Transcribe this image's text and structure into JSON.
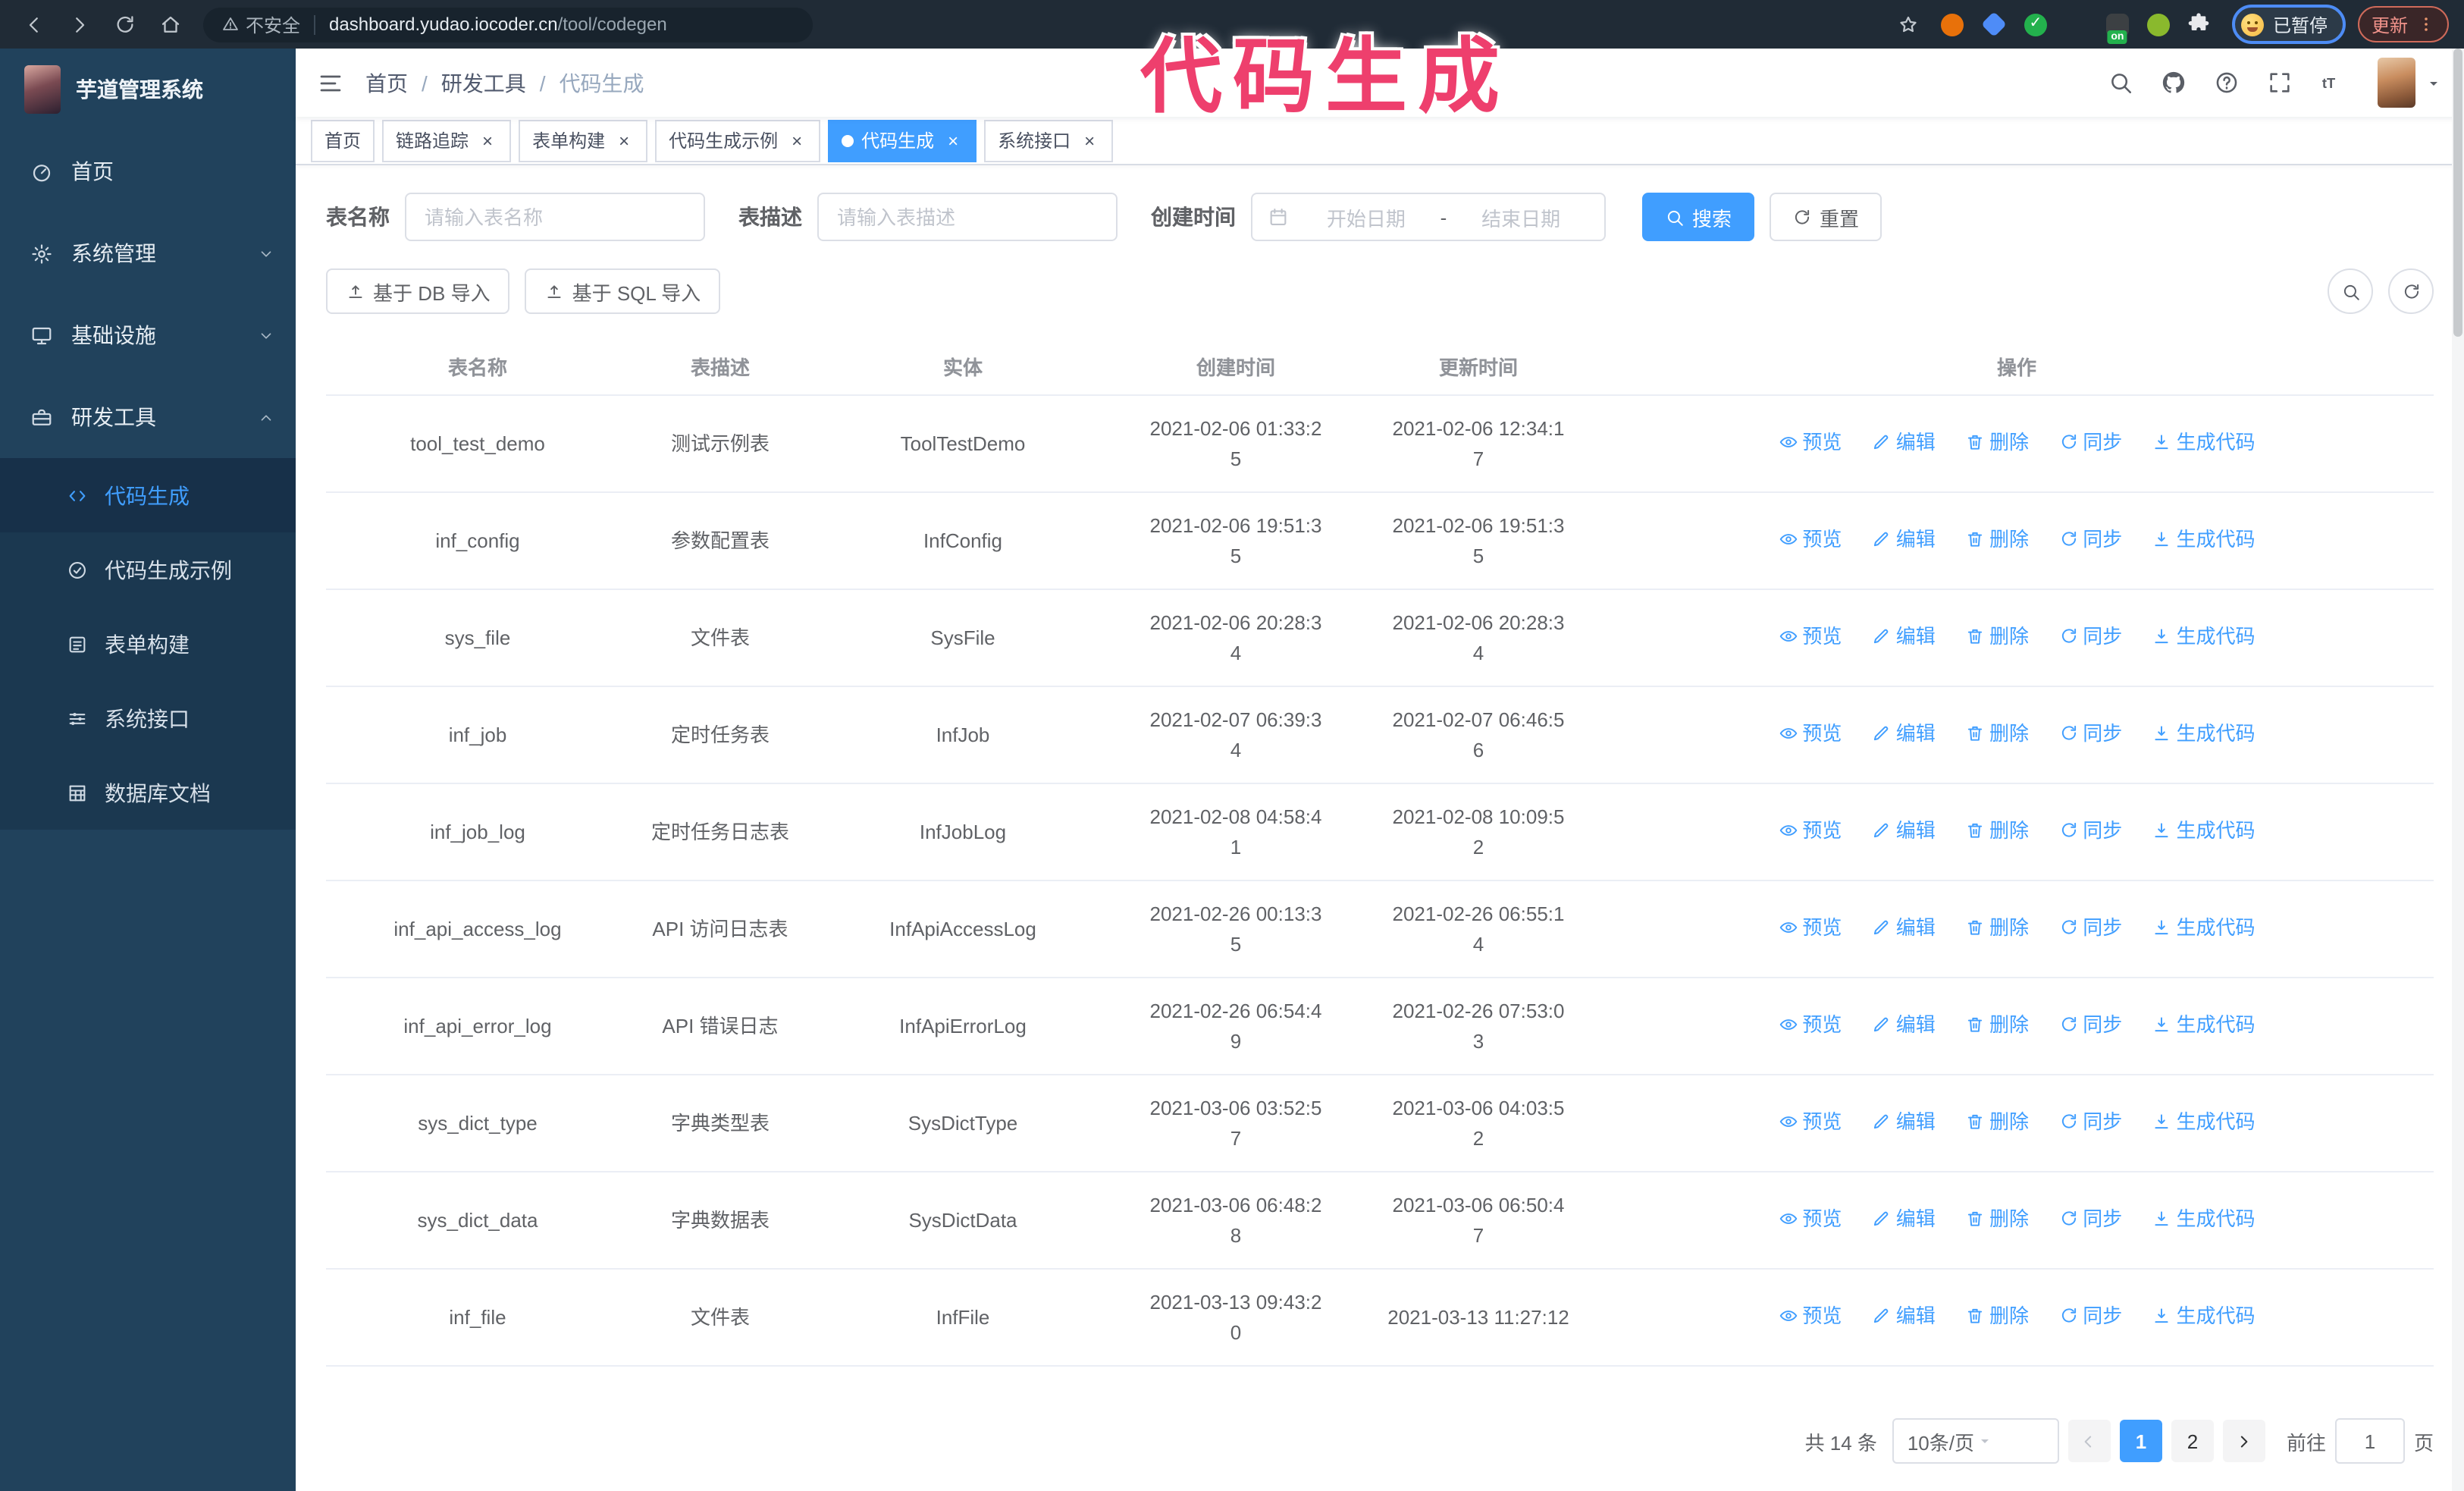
{
  "colors": {
    "accent": "#409eff",
    "annotation": "#ee3f6d",
    "sidebar_bg": "#21425c",
    "submenu_bg": "#1b3850",
    "chrome_bg": "#202b36"
  },
  "annotation": {
    "text": "代码生成"
  },
  "browser": {
    "nav_icons": [
      {
        "name": "back-icon"
      },
      {
        "name": "forward-icon"
      },
      {
        "name": "reload-icon"
      },
      {
        "name": "home-icon"
      }
    ],
    "security_icon": "warning-icon",
    "security_label": "不安全",
    "url_host": "dashboard.yudao.iocoder.cn",
    "url_path": "/tool/codegen",
    "star_icon": "star-icon",
    "extensions": [
      {
        "name": "orange-extension-icon",
        "shape": "circle",
        "color": "#e8710a"
      },
      {
        "name": "blue-gem-extension-icon",
        "shape": "diamond",
        "color": "#4e8cf7"
      },
      {
        "name": "green-shield-extension-icon",
        "shape": "circle",
        "color": "#23b14d",
        "glyph": "✓"
      },
      {
        "name": "grid-extension-icon",
        "shape": "grid",
        "color": "#aeb4ba"
      },
      {
        "name": "dark-extension-icon",
        "shape": "square",
        "color": "#3c4043",
        "badge": "on"
      },
      {
        "name": "green-bot-extension-icon",
        "shape": "circle",
        "color": "#8ab92d"
      },
      {
        "name": "puzzle-extension-icon",
        "shape": "puzzle",
        "color": "#e8eaed"
      }
    ],
    "paused_label": "已暂停",
    "update_label": "更新",
    "update_menu_icon": "dots-vertical-icon"
  },
  "sidebar": {
    "title": "芋道管理系统",
    "items": [
      {
        "id": "home",
        "label": "首页",
        "icon": "dashboard-icon",
        "chevron": null
      },
      {
        "id": "system",
        "label": "系统管理",
        "icon": "gear-icon",
        "chevron": "chevron-down-icon"
      },
      {
        "id": "infra",
        "label": "基础设施",
        "icon": "monitor-icon",
        "chevron": "chevron-down-icon"
      },
      {
        "id": "devtools",
        "label": "研发工具",
        "icon": "toolbox-icon",
        "chevron": "chevron-up-icon"
      }
    ],
    "subitems": [
      {
        "id": "codegen",
        "label": "代码生成",
        "icon": "code-icon",
        "active": true
      },
      {
        "id": "codegen-example",
        "label": "代码生成示例",
        "icon": "example-icon",
        "active": false
      },
      {
        "id": "form-builder",
        "label": "表单构建",
        "icon": "form-icon",
        "active": false
      },
      {
        "id": "system-api",
        "label": "系统接口",
        "icon": "api-icon",
        "active": false
      },
      {
        "id": "db-doc",
        "label": "数据库文档",
        "icon": "database-icon",
        "active": false
      }
    ]
  },
  "navbar": {
    "hamburger_icon": "hamburger-icon",
    "breadcrumb": [
      "首页",
      "研发工具",
      "代码生成"
    ],
    "breadcrumb_separator": "/",
    "icons": [
      {
        "name": "search-icon"
      },
      {
        "name": "github-icon"
      },
      {
        "name": "help-icon"
      },
      {
        "name": "fullscreen-icon"
      },
      {
        "name": "font-size-icon"
      }
    ],
    "avatar_caret_icon": "caret-down-icon"
  },
  "tags": [
    {
      "label": "首页",
      "closable": false,
      "active": false
    },
    {
      "label": "链路追踪",
      "closable": true,
      "active": false
    },
    {
      "label": "表单构建",
      "closable": true,
      "active": false
    },
    {
      "label": "代码生成示例",
      "closable": true,
      "active": false
    },
    {
      "label": "代码生成",
      "closable": true,
      "active": true
    },
    {
      "label": "系统接口",
      "closable": true,
      "active": false
    }
  ],
  "tag_close_glyph": "×",
  "search_form": {
    "name_label": "表名称",
    "name_placeholder": "请输入表名称",
    "desc_label": "表描述",
    "desc_placeholder": "请输入表描述",
    "time_label": "创建时间",
    "calendar_icon": "calendar-icon",
    "start_placeholder": "开始日期",
    "range_separator": "-",
    "end_placeholder": "结束日期",
    "search_button": "搜索",
    "search_icon": "search-icon",
    "reset_button": "重置",
    "reset_icon": "refresh-icon"
  },
  "toolbar": {
    "import_db_label": "基于 DB 导入",
    "import_sql_label": "基于 SQL 导入",
    "import_icon": "upload-icon",
    "circle_buttons": [
      {
        "name": "show-search-button",
        "icon": "search-icon"
      },
      {
        "name": "refresh-button",
        "icon": "refresh-icon"
      }
    ]
  },
  "table": {
    "headers": [
      "表名称",
      "表描述",
      "实体",
      "创建时间",
      "更新时间",
      "操作"
    ],
    "actions": [
      {
        "label": "预览",
        "icon": "eye-icon",
        "name": "preview-link"
      },
      {
        "label": "编辑",
        "icon": "edit-icon",
        "name": "edit-link"
      },
      {
        "label": "删除",
        "icon": "delete-icon",
        "name": "delete-link"
      },
      {
        "label": "同步",
        "icon": "sync-icon",
        "name": "sync-link"
      },
      {
        "label": "生成代码",
        "icon": "download-icon",
        "name": "generate-code-link"
      }
    ],
    "rows": [
      {
        "name": "tool_test_demo",
        "desc": "测试示例表",
        "entity": "ToolTestDemo",
        "created": "2021-02-06 01:33:25",
        "updated": "2021-02-06 12:34:17"
      },
      {
        "name": "inf_config",
        "desc": "参数配置表",
        "entity": "InfConfig",
        "created": "2021-02-06 19:51:35",
        "updated": "2021-02-06 19:51:35"
      },
      {
        "name": "sys_file",
        "desc": "文件表",
        "entity": "SysFile",
        "created": "2021-02-06 20:28:34",
        "updated": "2021-02-06 20:28:34"
      },
      {
        "name": "inf_job",
        "desc": "定时任务表",
        "entity": "InfJob",
        "created": "2021-02-07 06:39:34",
        "updated": "2021-02-07 06:46:56"
      },
      {
        "name": "inf_job_log",
        "desc": "定时任务日志表",
        "entity": "InfJobLog",
        "created": "2021-02-08 04:58:41",
        "updated": "2021-02-08 10:09:52"
      },
      {
        "name": "inf_api_access_log",
        "desc": "API 访问日志表",
        "entity": "InfApiAccessLog",
        "created": "2021-02-26 00:13:35",
        "updated": "2021-02-26 06:55:14"
      },
      {
        "name": "inf_api_error_log",
        "desc": "API 错误日志",
        "entity": "InfApiErrorLog",
        "created": "2021-02-26 06:54:49",
        "updated": "2021-02-26 07:53:03"
      },
      {
        "name": "sys_dict_type",
        "desc": "字典类型表",
        "entity": "SysDictType",
        "created": "2021-03-06 03:52:57",
        "updated": "2021-03-06 04:03:52"
      },
      {
        "name": "sys_dict_data",
        "desc": "字典数据表",
        "entity": "SysDictData",
        "created": "2021-03-06 06:48:28",
        "updated": "2021-03-06 06:50:47"
      },
      {
        "name": "inf_file",
        "desc": "文件表",
        "entity": "InfFile",
        "created": "2021-03-13 09:43:20",
        "updated": "2021-03-13 11:27:12"
      }
    ]
  },
  "pagination": {
    "total_label": "共 14 条",
    "page_size_label": "10条/页",
    "page_size_caret_icon": "caret-down-icon",
    "prev_icon": "chevron-left-icon",
    "next_icon": "chevron-right-icon",
    "pages": [
      "1",
      "2"
    ],
    "active_page": "1",
    "goto_label": "前往",
    "goto_value": "1",
    "goto_suffix": "页"
  }
}
